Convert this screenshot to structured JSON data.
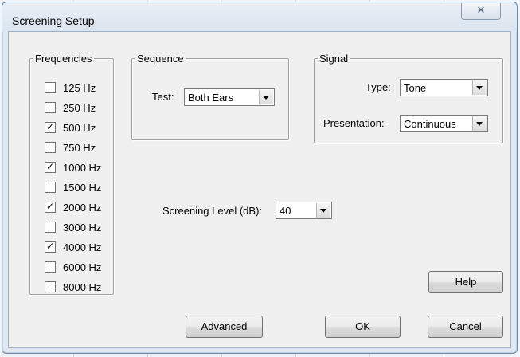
{
  "window": {
    "title": "Screening Setup",
    "close_glyph": "✕",
    "close_icon": "close-icon"
  },
  "frequencies": {
    "legend": "Frequencies",
    "items": [
      {
        "label": "125 Hz",
        "checked": false
      },
      {
        "label": "250 Hz",
        "checked": false
      },
      {
        "label": "500 Hz",
        "checked": true
      },
      {
        "label": "750 Hz",
        "checked": false
      },
      {
        "label": "1000 Hz",
        "checked": true
      },
      {
        "label": "1500 Hz",
        "checked": false
      },
      {
        "label": "2000 Hz",
        "checked": true
      },
      {
        "label": "3000 Hz",
        "checked": false
      },
      {
        "label": "4000 Hz",
        "checked": true
      },
      {
        "label": "6000 Hz",
        "checked": false
      },
      {
        "label": "8000 Hz",
        "checked": false
      }
    ]
  },
  "sequence": {
    "legend": "Sequence",
    "test_label": "Test:",
    "test_value": "Both Ears"
  },
  "signal": {
    "legend": "Signal",
    "type_label": "Type:",
    "type_value": "Tone",
    "presentation_label": "Presentation:",
    "presentation_value": "Continuous"
  },
  "screening_level": {
    "label": "Screening Level (dB):",
    "value": "40"
  },
  "buttons": {
    "help": "Help",
    "advanced": "Advanced",
    "ok": "OK",
    "cancel": "Cancel"
  }
}
